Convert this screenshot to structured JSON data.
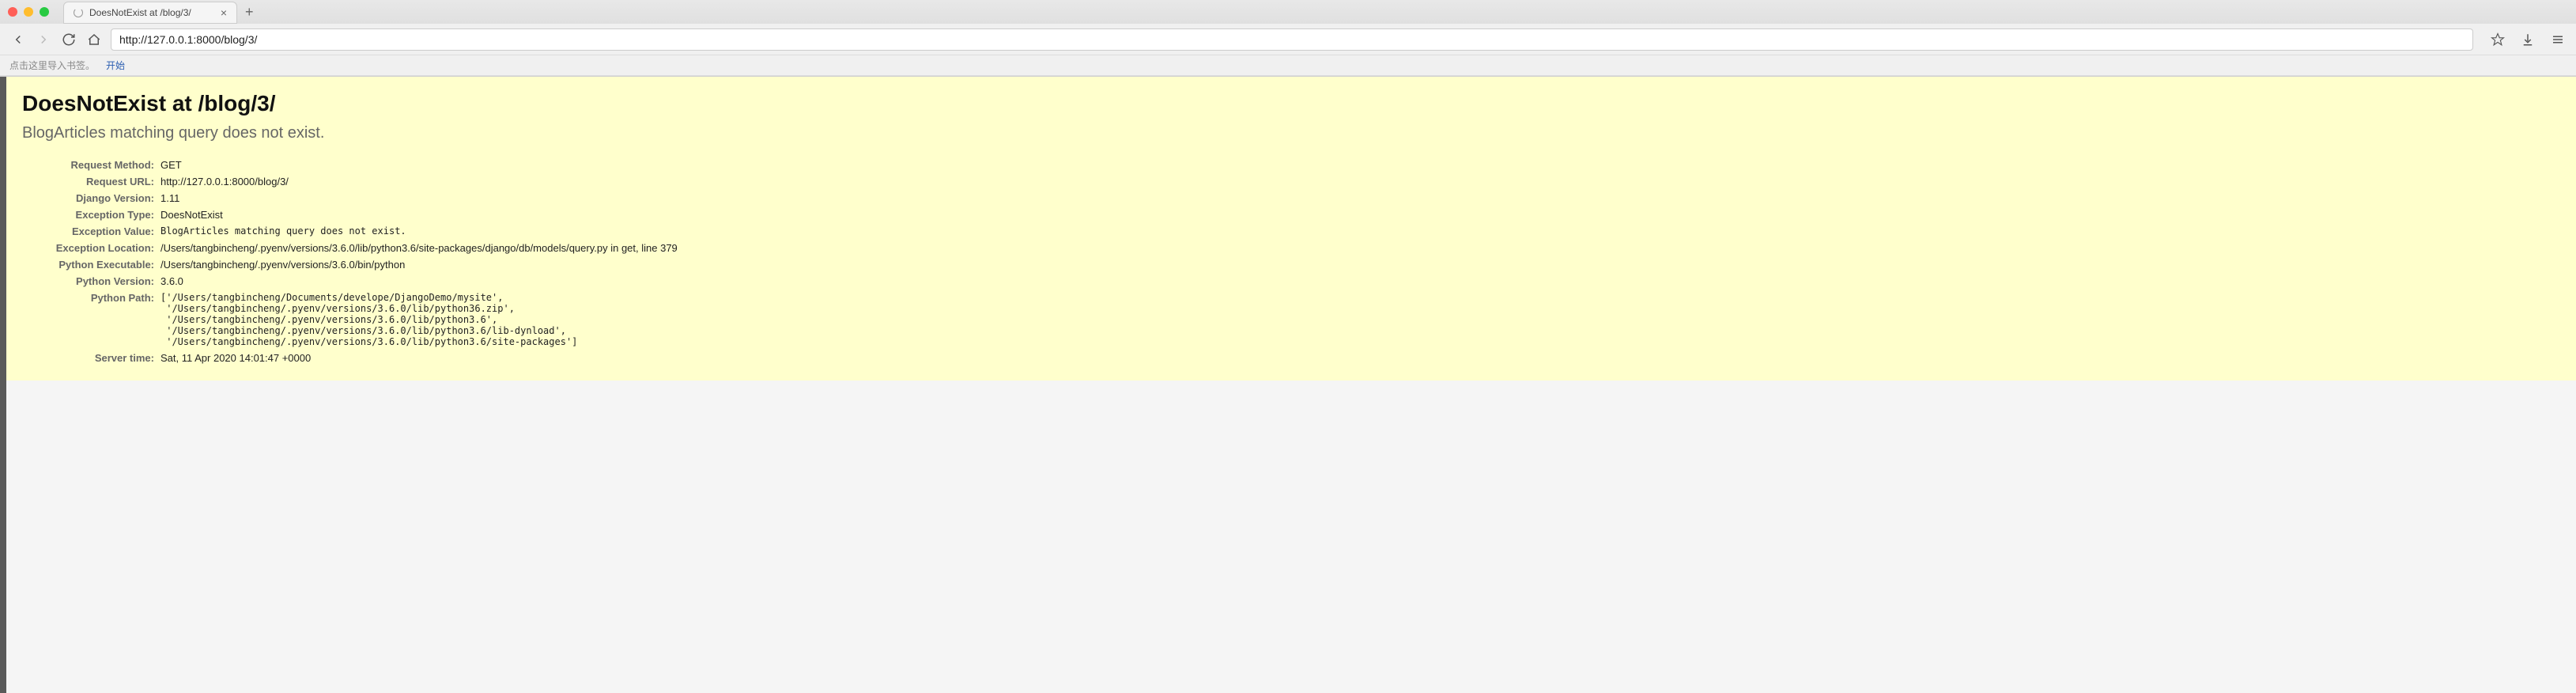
{
  "browser": {
    "tab_title": "DoesNotExist at /blog/3/",
    "url": "http://127.0.0.1:8000/blog/3/",
    "bookmarks_hint": "点击这里导入书签。",
    "bookmark_start": "开始"
  },
  "error": {
    "heading": "DoesNotExist at /blog/3/",
    "subheading": "BlogArticles matching query does not exist.",
    "rows": {
      "request_method": {
        "label": "Request Method:",
        "value": "GET"
      },
      "request_url": {
        "label": "Request URL:",
        "value": "http://127.0.0.1:8000/blog/3/"
      },
      "django_version": {
        "label": "Django Version:",
        "value": "1.11"
      },
      "exception_type": {
        "label": "Exception Type:",
        "value": "DoesNotExist"
      },
      "exception_value": {
        "label": "Exception Value:",
        "value": "BlogArticles matching query does not exist."
      },
      "exception_location": {
        "label": "Exception Location:",
        "value": "/Users/tangbincheng/.pyenv/versions/3.6.0/lib/python3.6/site-packages/django/db/models/query.py in get, line 379"
      },
      "python_executable": {
        "label": "Python Executable:",
        "value": "/Users/tangbincheng/.pyenv/versions/3.6.0/bin/python"
      },
      "python_version": {
        "label": "Python Version:",
        "value": "3.6.0"
      },
      "python_path": {
        "label": "Python Path:",
        "value": "['/Users/tangbincheng/Documents/develope/DjangoDemo/mysite',\n '/Users/tangbincheng/.pyenv/versions/3.6.0/lib/python36.zip',\n '/Users/tangbincheng/.pyenv/versions/3.6.0/lib/python3.6',\n '/Users/tangbincheng/.pyenv/versions/3.6.0/lib/python3.6/lib-dynload',\n '/Users/tangbincheng/.pyenv/versions/3.6.0/lib/python3.6/site-packages']"
      },
      "server_time": {
        "label": "Server time:",
        "value": "Sat, 11 Apr 2020 14:01:47 +0000"
      }
    }
  }
}
